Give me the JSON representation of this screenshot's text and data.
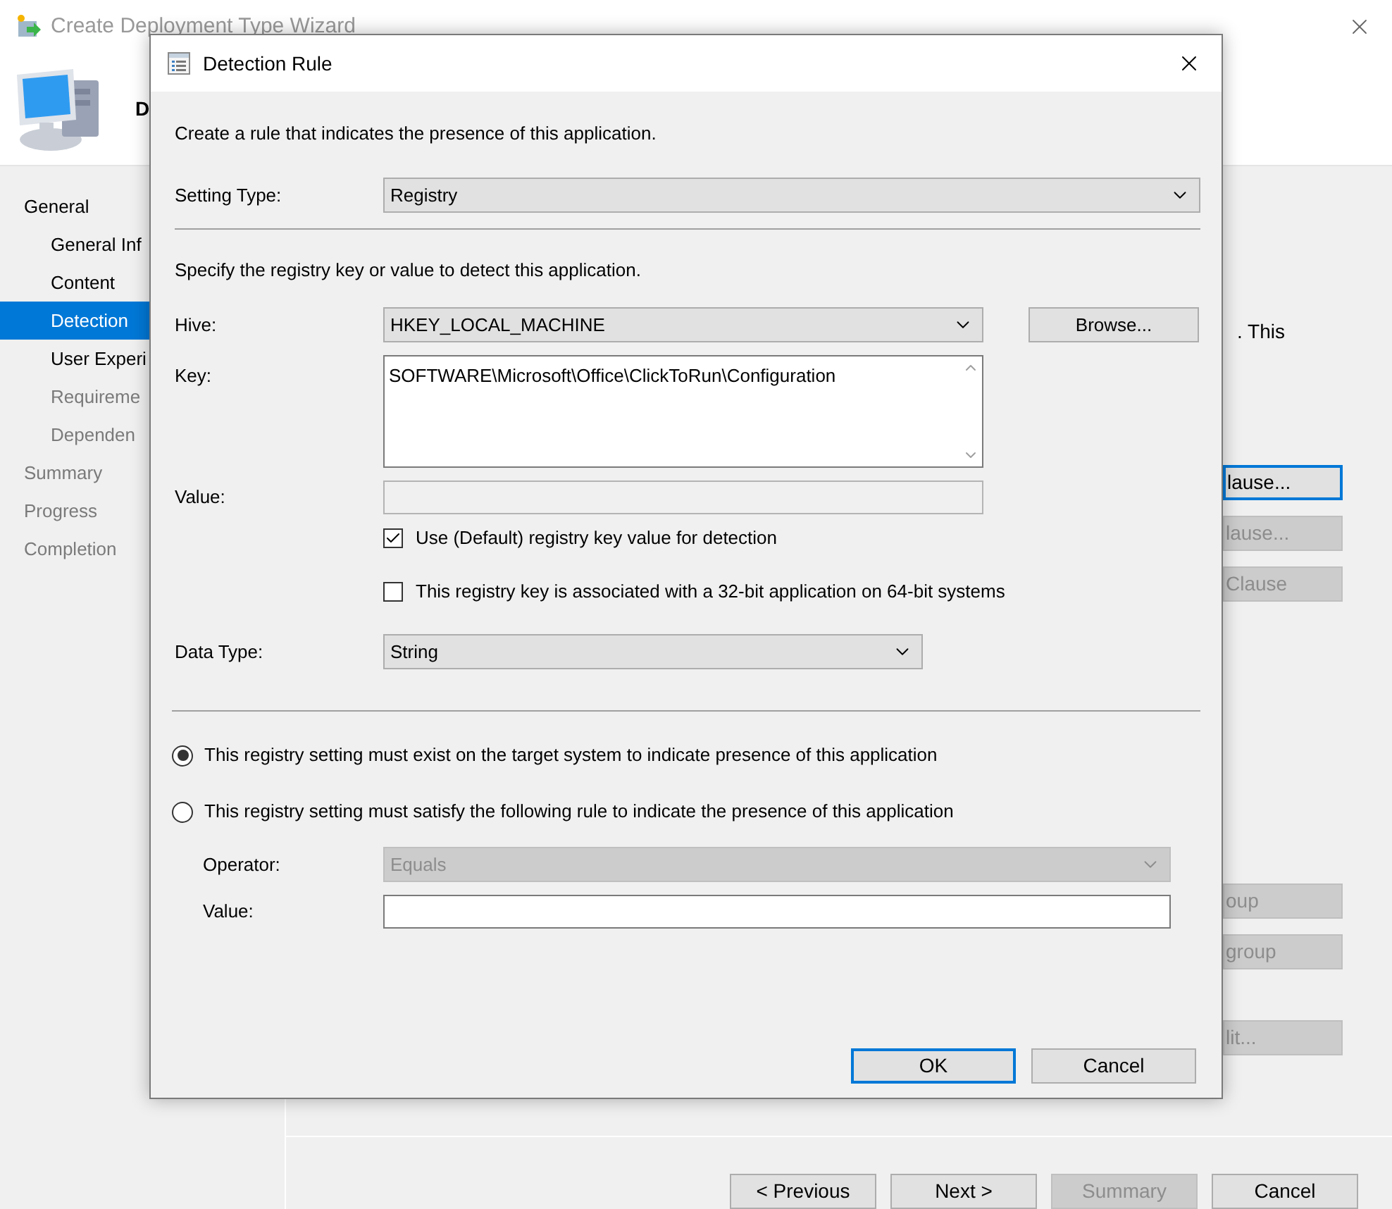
{
  "wizard": {
    "title": "Create Deployment Type Wizard",
    "header_text": "D",
    "nav": [
      {
        "label": "General",
        "selected": false,
        "disabled": false,
        "children": [
          {
            "label": "General Inf",
            "selected": false,
            "disabled": false
          },
          {
            "label": "Content",
            "selected": false,
            "disabled": false
          },
          {
            "label": "Detection",
            "selected": true,
            "disabled": false
          },
          {
            "label": "User Experi",
            "selected": false,
            "disabled": false
          },
          {
            "label": "Requireme",
            "selected": false,
            "disabled": true
          },
          {
            "label": "Dependen",
            "selected": false,
            "disabled": true
          }
        ]
      },
      {
        "label": "Summary",
        "selected": false,
        "disabled": true
      },
      {
        "label": "Progress",
        "selected": false,
        "disabled": true
      },
      {
        "label": "Completion",
        "selected": false,
        "disabled": true
      }
    ],
    "partial_text": ". This",
    "side_buttons": [
      {
        "label": "lause...",
        "disabled": false,
        "focused": true
      },
      {
        "label": "lause...",
        "disabled": true,
        "focused": false
      },
      {
        "label": "Clause",
        "disabled": true,
        "focused": false
      },
      {
        "label": "oup",
        "disabled": true,
        "focused": false
      },
      {
        "label": "group",
        "disabled": true,
        "focused": false
      },
      {
        "label": "lit...",
        "disabled": true,
        "focused": false
      }
    ],
    "footer_buttons": [
      {
        "label": "< Previous",
        "disabled": false
      },
      {
        "label": "Next >",
        "disabled": false
      },
      {
        "label": "Summary",
        "disabled": true
      },
      {
        "label": "Cancel",
        "disabled": false
      }
    ]
  },
  "dialog": {
    "title": "Detection Rule",
    "intro": "Create a rule that indicates the presence of this application.",
    "setting_type": {
      "label": "Setting Type:",
      "value": "Registry"
    },
    "specify_text": "Specify the registry key or value to detect this application.",
    "hive": {
      "label": "Hive:",
      "value": "HKEY_LOCAL_MACHINE"
    },
    "browse_button": "Browse...",
    "key": {
      "label": "Key:",
      "value": "SOFTWARE\\Microsoft\\Office\\ClickToRun\\Configuration"
    },
    "value": {
      "label": "Value:",
      "disabled": true
    },
    "checkboxes": [
      {
        "label": "Use (Default) registry key value for detection",
        "checked": true
      },
      {
        "label": "This registry key is associated with a 32-bit application on 64-bit systems",
        "checked": false
      }
    ],
    "data_type": {
      "label": "Data Type:",
      "value": "String"
    },
    "radios": [
      {
        "label": "This registry setting must exist on the target system to indicate presence of this application",
        "selected": true
      },
      {
        "label": "This registry setting must satisfy the following rule to indicate the presence of this application",
        "selected": false
      }
    ],
    "operator": {
      "label": "Operator:",
      "value": "Equals",
      "disabled": true
    },
    "rule_value": {
      "label": "Value:"
    },
    "buttons": [
      {
        "label": "OK",
        "focused": true
      },
      {
        "label": "Cancel",
        "focused": false
      }
    ]
  }
}
